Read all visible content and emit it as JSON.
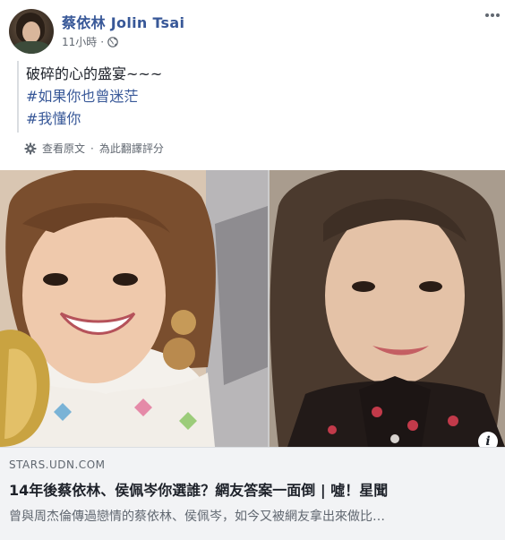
{
  "post": {
    "author": "蔡依林 Jolin Tsai",
    "time": "11小時",
    "separator": "·",
    "privacy_icon": "globe-icon",
    "text_lines": [
      "破碎的心的盛宴~~~"
    ],
    "hashtags": [
      "#如果你也曾迷茫",
      "#我懂你"
    ],
    "view_original": "查看原文",
    "rate_translation": "為此翻譯評分",
    "translate_separator": "·"
  },
  "link": {
    "domain": "STARS.UDN.COM",
    "title": "14年後蔡依林、侯佩岑你選誰？網友答案一面倒 | 噓！星聞",
    "description": "曾與周杰倫傳過戀情的蔡依林、侯佩岑，如今又被網友拿出來做比…",
    "info_icon": "i"
  },
  "colors": {
    "link_blue": "#385898",
    "meta_gray": "#606770",
    "link_box_bg": "#f2f3f5"
  }
}
